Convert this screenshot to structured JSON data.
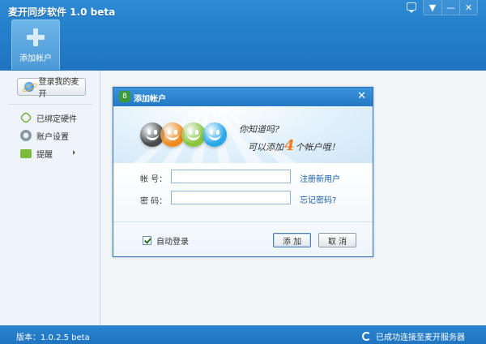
{
  "app": {
    "title": "麦开同步软件 1.0 beta",
    "window_controls": {
      "menu": "▼",
      "minimize": "—",
      "close": "✕"
    }
  },
  "toolbar": {
    "add_account_label": "添加帐户"
  },
  "sidebar": {
    "open_button_label": "登录我的麦开",
    "items": [
      {
        "label": "已绑定硬件",
        "icon": "link-icon"
      },
      {
        "label": "账户设置",
        "icon": "gear-icon"
      },
      {
        "label": "提醒",
        "icon": "speech-bubble-icon"
      }
    ]
  },
  "dialog": {
    "title": "添加帐户",
    "banner_line1": "你知道吗?",
    "banner_line2_prefix": "可以添加",
    "banner_number": "4",
    "banner_line2_suffix": "个帐户哦！",
    "account_label": "帐  号：",
    "account_value": "",
    "password_label": "密  码：",
    "password_value": "",
    "register_link": "注册新用户",
    "forgot_link": "忘记密码?",
    "auto_login_label": "自动登录",
    "auto_login_checked": true,
    "add_button": "添 加",
    "cancel_button": "取 消",
    "smiley_colors": [
      "#4a4a4a",
      "#f08a1c",
      "#8cc63f",
      "#2aa8e8"
    ]
  },
  "statusbar": {
    "version": "版本：1.0.2.5 beta",
    "connection": "已成功连接至麦开服务器"
  },
  "colors": {
    "accent": "#2580cc",
    "link": "#1a5ea8",
    "highlight_number": "#f07a1e"
  }
}
